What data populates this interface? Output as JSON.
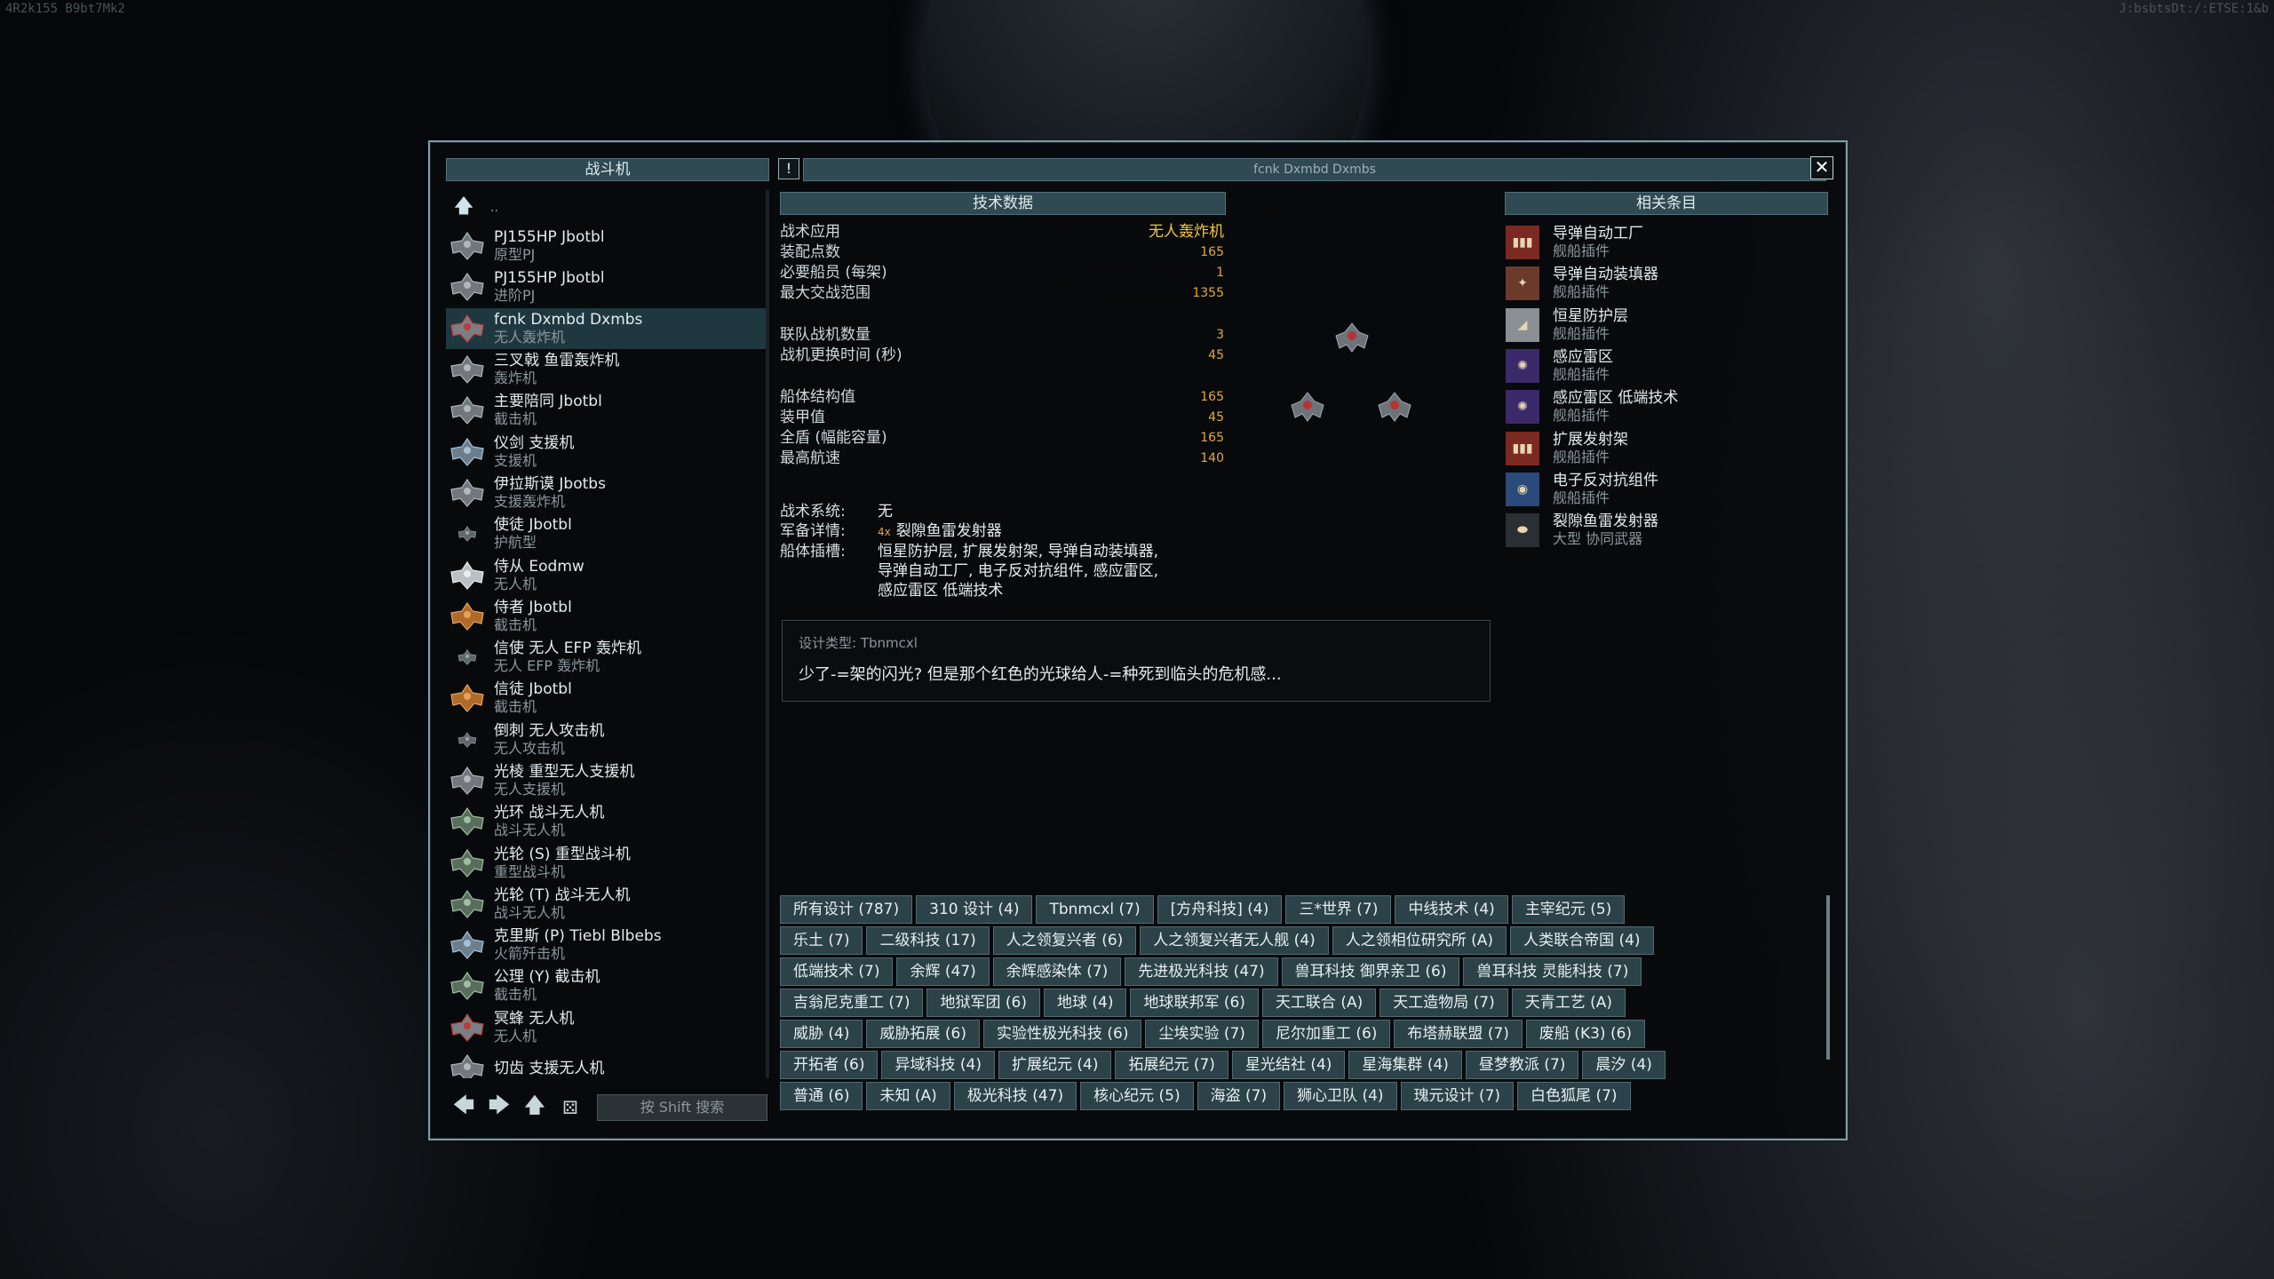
{
  "corner": {
    "left": "4R2k155 B9bt7Mk2",
    "right": "J:bsbtsDt:/:ETSE:1&b"
  },
  "left_panel": {
    "title": "战斗机",
    "up_dots": "..",
    "items": [
      {
        "name": "PJ155HP Jbotbl",
        "type": "原型PJ",
        "icon": "ship-gray"
      },
      {
        "name": "PJ155HP Jbotbl",
        "type": "进阶PJ",
        "icon": "ship-gray"
      },
      {
        "name": "fcnk Dxmbd Dxmbs",
        "type": "无人轰炸机",
        "icon": "ship-red"
      },
      {
        "name": "三叉戟 鱼雷轰炸机",
        "type": "轰炸机",
        "icon": "ship-gray"
      },
      {
        "name": "主要陪同 Jbotbl",
        "type": "截击机",
        "icon": "ship-gray"
      },
      {
        "name": "仪剑 支援机",
        "type": "支援机",
        "icon": "ship-blue"
      },
      {
        "name": "伊拉斯谟 Jbotbs",
        "type": "支援轰炸机",
        "icon": "ship-gray"
      },
      {
        "name": "使徒 Jbotbl",
        "type": "护航型",
        "icon": "ship-small"
      },
      {
        "name": "侍从 Eodmw",
        "type": "无人机",
        "icon": "ship-white"
      },
      {
        "name": "侍者 Jbotbl",
        "type": "截击机",
        "icon": "ship-orange"
      },
      {
        "name": "信使 无人 EFP 轰炸机",
        "type": "无人 EFP 轰炸机",
        "icon": "ship-small"
      },
      {
        "name": "信徒 Jbotbl",
        "type": "截击机",
        "icon": "ship-orange"
      },
      {
        "name": "倒刺 无人攻击机",
        "type": "无人攻击机",
        "icon": "ship-small"
      },
      {
        "name": "光棱 重型无人支援机",
        "type": "无人支援机",
        "icon": "ship-gray"
      },
      {
        "name": "光环 战斗无人机",
        "type": "战斗无人机",
        "icon": "ship-green"
      },
      {
        "name": "光轮 (S) 重型战斗机",
        "type": "重型战斗机",
        "icon": "ship-green"
      },
      {
        "name": "光轮 (T) 战斗无人机",
        "type": "战斗无人机",
        "icon": "ship-green"
      },
      {
        "name": "克里斯 (P) Tiebl Blbebs",
        "type": "火箭歼击机",
        "icon": "ship-blue"
      },
      {
        "name": "公理 (Y) 截击机",
        "type": "截击机",
        "icon": "ship-green"
      },
      {
        "name": "冥蜂 无人机",
        "type": "无人机",
        "icon": "ship-red"
      },
      {
        "name": "切齿 支援无人机",
        "type": "",
        "icon": "ship-gray"
      }
    ],
    "search_placeholder": "按 Shift 搜索"
  },
  "main_title": "fcnk Dxmbd Dxmbs",
  "tech": {
    "title": "技术数据",
    "groups": [
      [
        {
          "k": "战术应用",
          "v": "无人轰炸机",
          "main": true
        },
        {
          "k": "装配点数",
          "v": "165"
        },
        {
          "k": "必要船员 (每架)",
          "v": "1"
        },
        {
          "k": "最大交战范围",
          "v": "1355"
        }
      ],
      [
        {
          "k": "联队战机数量",
          "v": "3"
        },
        {
          "k": "战机更换时间 (秒)",
          "v": "45"
        }
      ],
      [
        {
          "k": "船体结构值",
          "v": "165"
        },
        {
          "k": "装甲值",
          "v": "45"
        },
        {
          "k": "全盾 (幅能容量)",
          "v": "165"
        },
        {
          "k": "最高航速",
          "v": "140"
        }
      ]
    ]
  },
  "systems": {
    "tactical_k": "战术系统:",
    "tactical_v": "无",
    "armament_k": "军备详情:",
    "armament_num": "4x",
    "armament_v": "裂隙鱼雷发射器",
    "slots_k": "船体插槽:",
    "slots_lines": [
      "恒星防护层, 扩展发射架, 导弹自动装填器,",
      "导弹自动工厂, 电子反对抗组件, 感应雷区,",
      "感应雷区 低端技术"
    ]
  },
  "description": {
    "type_label": "设计类型: Tbnmcxl",
    "text": "少了-=架的闪光? 但是那个红色的光球给人-=种死到临头的危机感..."
  },
  "related": {
    "title": "相关条目",
    "items": [
      {
        "name": "导弹自动工厂",
        "type": "舰船插件",
        "icon": "missile-factory-icon"
      },
      {
        "name": "导弹自动装填器",
        "type": "舰船插件",
        "icon": "missile-loader-icon"
      },
      {
        "name": "恒星防护层",
        "type": "舰船插件",
        "icon": "stellar-shield-icon"
      },
      {
        "name": "感应雷区",
        "type": "舰船插件",
        "icon": "mine-field-icon"
      },
      {
        "name": "感应雷区  低端技术",
        "type": "舰船插件",
        "icon": "mine-field-icon"
      },
      {
        "name": "扩展发射架",
        "type": "舰船插件",
        "icon": "missile-rack-icon"
      },
      {
        "name": "电子反对抗组件",
        "type": "舰船插件",
        "icon": "ecm-icon"
      },
      {
        "name": "裂隙鱼雷发射器",
        "type": "大型 协同武器",
        "icon": "torpedo-icon"
      }
    ]
  },
  "tags": [
    [
      "所有设计 (787)",
      "310 设计 (4)",
      "Tbnmcxl (7)",
      "[方舟科技] (4)",
      "三*世界 (7)",
      "中线技术 (4)",
      "主宰纪元 (5)"
    ],
    [
      "乐土 (7)",
      "二级科技 (17)",
      "人之领复兴者 (6)",
      "人之领复兴者无人舰 (4)",
      "人之领相位研究所 (A)",
      "人类联合帝国 (4)"
    ],
    [
      "低端技术 (7)",
      "余辉 (47)",
      "余辉感染体 (7)",
      "先进极光科技 (47)",
      "兽耳科技 御界亲卫 (6)",
      "兽耳科技 灵能科技 (7)"
    ],
    [
      "吉翁尼克重工 (7)",
      "地狱军团 (6)",
      "地球 (4)",
      "地球联邦军 (6)",
      "天工联合 (A)",
      "天工造物局 (7)",
      "天青工艺 (A)"
    ],
    [
      "威胁 (4)",
      "威胁拓展 (6)",
      "实验性极光科技 (6)",
      "尘埃实验 (7)",
      "尼尔加重工 (6)",
      "布塔赫联盟 (7)",
      "废船 (K3) (6)"
    ],
    [
      "开拓者 (6)",
      "异域科技 (4)",
      "扩展纪元 (4)",
      "拓展纪元 (7)",
      "星光结社 (4)",
      "星海集群 (4)",
      "昼梦教派 (7)",
      "晨汐 (4)"
    ],
    [
      "普通 (6)",
      "未知 (A)",
      "极光科技 (47)",
      "核心纪元 (5)",
      "海盗 (7)",
      "狮心卫队 (4)",
      "瑰元设计 (7)",
      "白色狐尾 (7)"
    ]
  ],
  "colors": {
    "accent": "#2f4a52",
    "value": "#e0a93a",
    "selected": "#1f3840"
  }
}
